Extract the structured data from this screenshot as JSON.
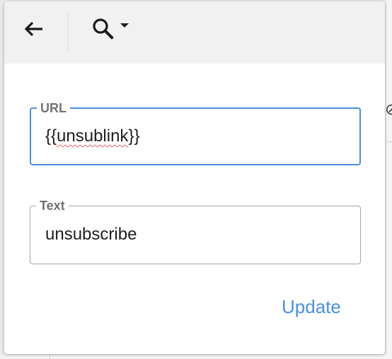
{
  "toolbar": {
    "back_icon": "arrow-left-icon",
    "search_icon": "magnifier-icon",
    "dropdown_icon": "caret-down-icon"
  },
  "form": {
    "url_label": "URL",
    "url_prefix": "{{",
    "url_word": "unsublink",
    "url_suffix": "}}",
    "text_label": "Text",
    "text_value": "unsubscribe"
  },
  "actions": {
    "update_label": "Update"
  },
  "colors": {
    "accent": "#4a90e2",
    "toolbar_bg": "#f1f1f1",
    "label_gray": "#707070"
  }
}
